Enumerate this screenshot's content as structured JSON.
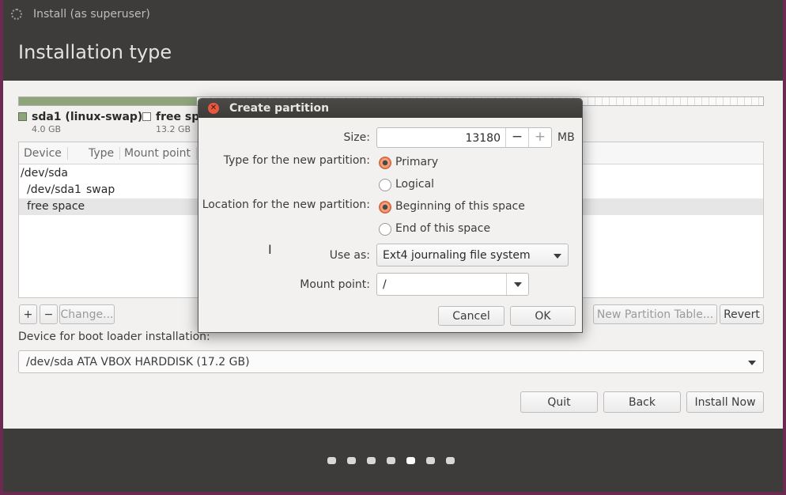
{
  "window": {
    "title": "Install (as superuser)"
  },
  "page": {
    "title": "Installation type"
  },
  "legend": [
    {
      "name": "sda1 (linux-swap)",
      "size": "4.0 GB",
      "color": "#8ea57a"
    },
    {
      "name": "free spa",
      "size": "13.2 GB",
      "color": "#ffffff"
    }
  ],
  "table": {
    "columns": [
      "Device",
      "Type",
      "Mount point"
    ],
    "rows": [
      {
        "device": "/dev/sda",
        "type": "",
        "selected": false
      },
      {
        "device": "/dev/sda1",
        "type": "swap",
        "selected": false
      },
      {
        "device": "free space",
        "type": "",
        "selected": true
      }
    ]
  },
  "table_buttons": {
    "add": "+",
    "remove": "−",
    "change": "Change...",
    "new_table": "New Partition Table...",
    "revert": "Revert"
  },
  "boot_loader": {
    "label": "Device for boot loader installation:",
    "value": "/dev/sda ATA VBOX HARDDISK (17.2 GB)"
  },
  "nav_buttons": {
    "quit": "Quit",
    "back": "Back",
    "install": "Install Now"
  },
  "progress_dots": {
    "total": 7,
    "current": 5
  },
  "dialog": {
    "title": "Create partition",
    "size_label": "Size:",
    "size_value": "13180",
    "size_unit": "MB",
    "decrement": "−",
    "increment": "+",
    "type_label": "Type for the new partition:",
    "type_options": [
      {
        "label": "Primary",
        "selected": true
      },
      {
        "label": "Logical",
        "selected": false
      }
    ],
    "location_label": "Location for the new partition:",
    "location_options": [
      {
        "label": "Beginning of this space",
        "selected": true
      },
      {
        "label": "End of this space",
        "selected": false
      }
    ],
    "use_as_label": "Use as:",
    "use_as_value": "Ext4 journaling file system",
    "mount_label": "Mount point:",
    "mount_value": "/",
    "cancel": "Cancel",
    "ok": "OK"
  },
  "colors": {
    "accent": "#e9704a",
    "swap": "#8ea57a",
    "window_bg": "#3d3c3a"
  }
}
